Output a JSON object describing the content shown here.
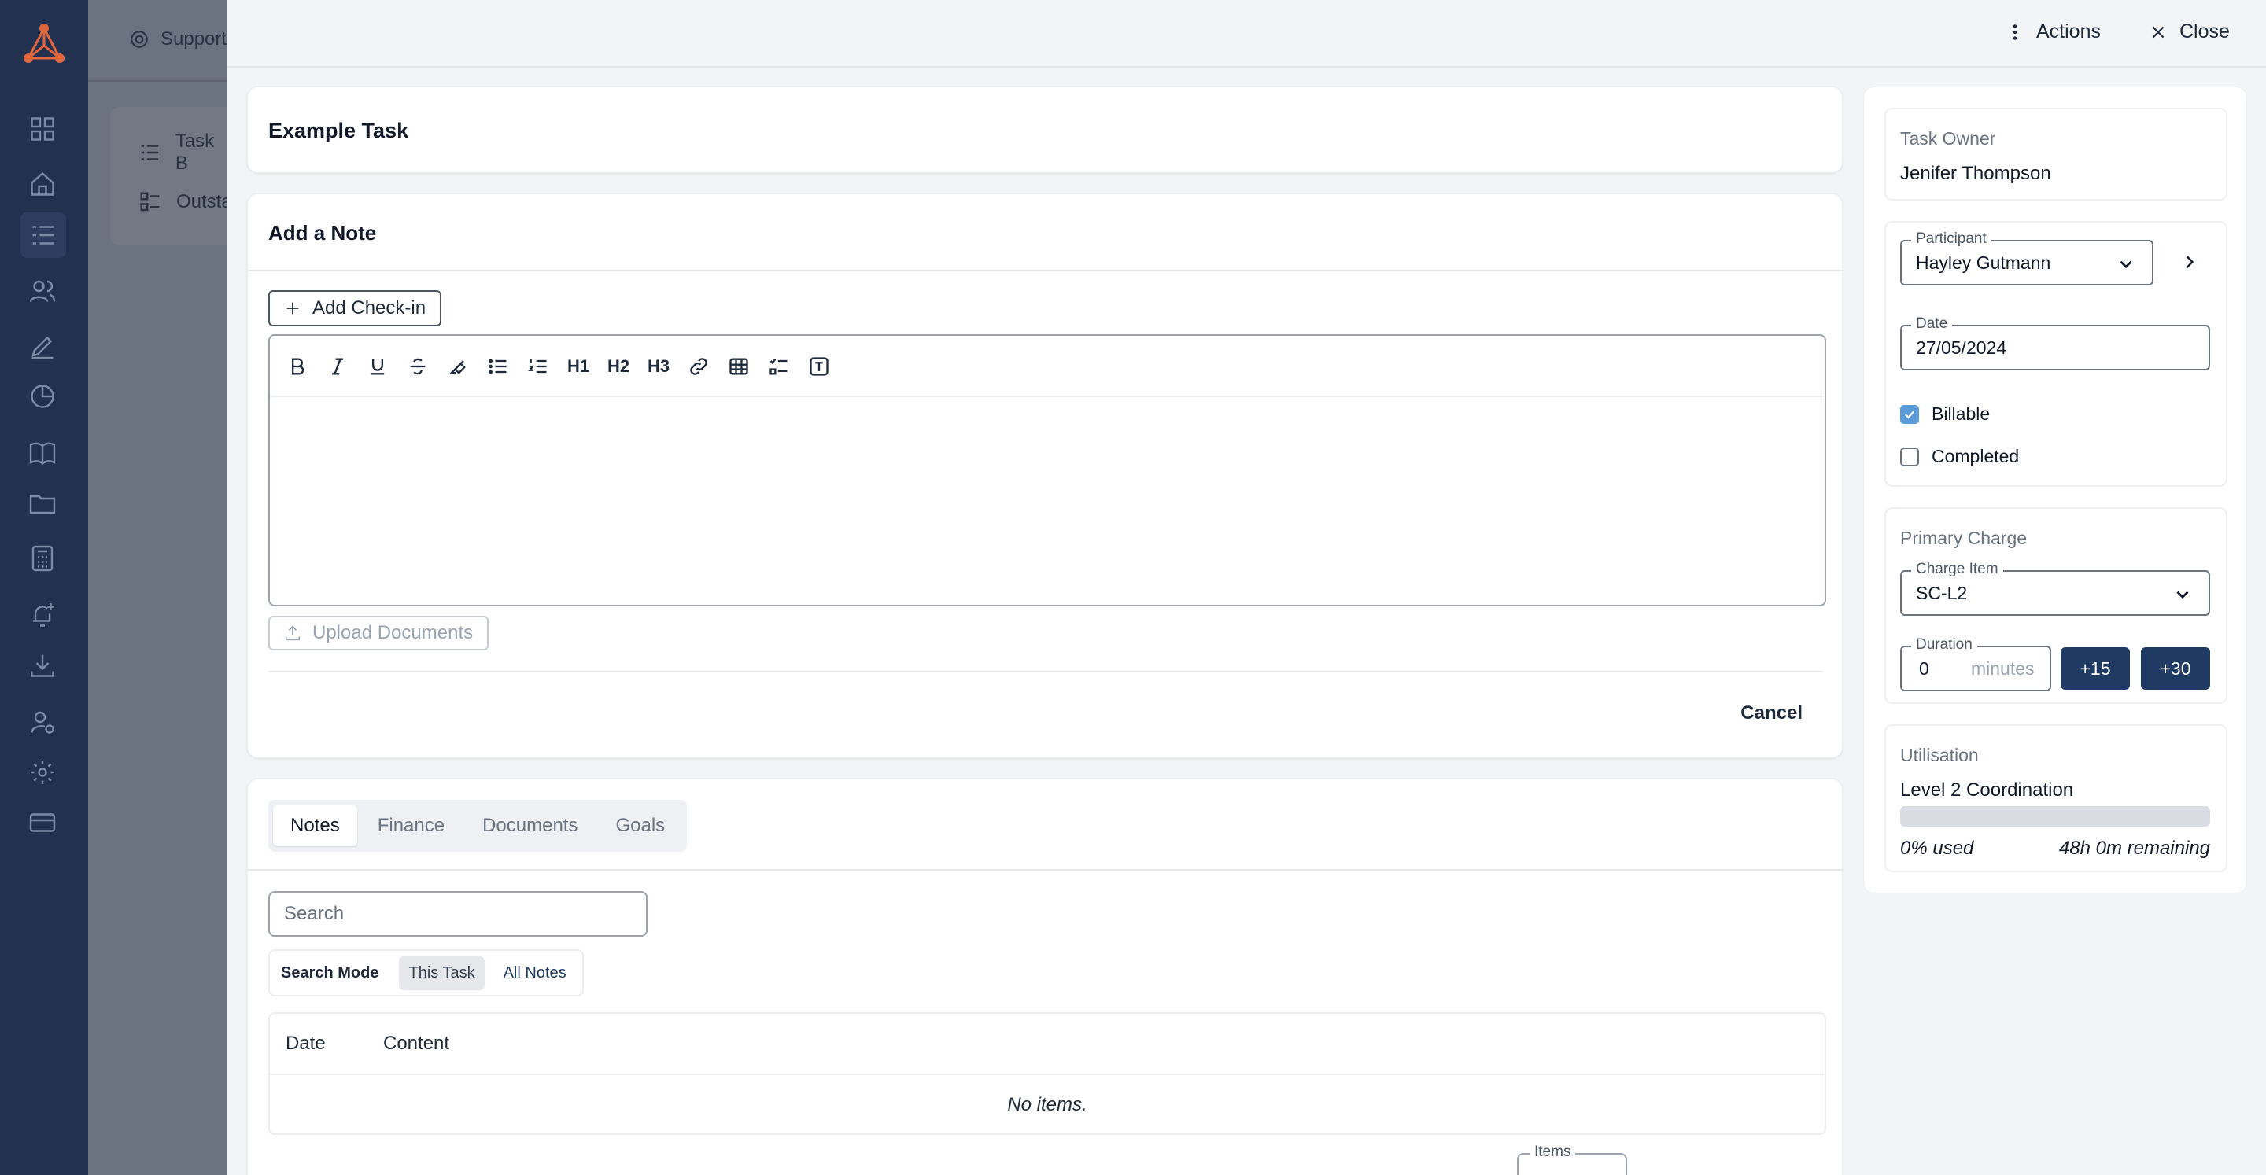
{
  "background": {
    "header_label": "Support",
    "items": [
      "Task B",
      "Outsta"
    ]
  },
  "drawer": {
    "actions_label": "Actions",
    "close_label": "Close"
  },
  "task": {
    "title": "Example Task"
  },
  "note": {
    "heading": "Add a Note",
    "add_checkin_label": "Add Check-in",
    "toolbar_headings": [
      "H1",
      "H2",
      "H3"
    ],
    "upload_label": "Upload Documents",
    "cancel_label": "Cancel"
  },
  "lower": {
    "tabs": [
      "Notes",
      "Finance",
      "Documents",
      "Goals"
    ],
    "active_tab": "Notes",
    "search_placeholder": "Search",
    "search_mode_label": "Search Mode",
    "mode_options": [
      "This Task",
      "All Notes"
    ],
    "active_mode": "This Task",
    "columns": [
      "Date",
      "Content"
    ],
    "empty_text": "No items.",
    "pager_label": "Items"
  },
  "side": {
    "owner_label": "Task Owner",
    "owner_value": "Jenifer Thompson",
    "participant_legend": "Participant",
    "participant_value": "Hayley Gutmann",
    "date_legend": "Date",
    "date_value": "27/05/2024",
    "billable_label": "Billable",
    "billable_checked": true,
    "completed_label": "Completed",
    "completed_checked": false,
    "charge_heading": "Primary Charge",
    "charge_item_legend": "Charge Item",
    "charge_item_value": "SC-L2",
    "duration_legend": "Duration",
    "duration_value": "0",
    "duration_unit": "minutes",
    "plus15_label": "+15",
    "plus30_label": "+30",
    "utilisation_heading": "Utilisation",
    "utilisation_item": "Level 2 Coordination",
    "utilisation_used_fraction": 0,
    "used_text": "0% used",
    "remaining_text": "48h 0m remaining"
  },
  "colors": {
    "sidebar": "#233150",
    "drawer_bg": "#f3f4f6",
    "primary_button": "#1f3a63",
    "checkbox_checked": "#5b9bd8"
  }
}
